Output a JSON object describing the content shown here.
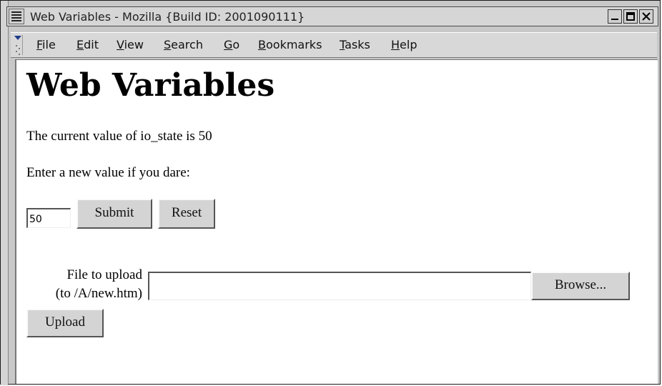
{
  "window": {
    "title": "Web Variables - Mozilla {Build ID: 2001090111}"
  },
  "menubar": {
    "items": [
      {
        "label": "File",
        "underline": "F",
        "rest": "ile"
      },
      {
        "label": "Edit",
        "underline": "E",
        "rest": "dit"
      },
      {
        "label": "View",
        "underline": "V",
        "rest": "iew"
      },
      {
        "label": "Search",
        "underline": "S",
        "rest": "earch"
      },
      {
        "label": "Go",
        "underline": "G",
        "rest": "o"
      },
      {
        "label": "Bookmarks",
        "underline": "B",
        "rest": "ookmarks"
      },
      {
        "label": "Tasks",
        "underline": "T",
        "rest": "asks"
      },
      {
        "label": "Help",
        "underline": "H",
        "rest": "elp"
      }
    ]
  },
  "page": {
    "heading": "Web Variables",
    "current_value_text": "The current value of io_state is 50",
    "prompt_text": "Enter a new value if you dare:",
    "value_input": "50",
    "submit_label": "Submit",
    "reset_label": "Reset",
    "upload_label_line1": "File to upload",
    "upload_label_line2": "(to /A/new.htm)",
    "file_input_value": "",
    "browse_label": "Browse...",
    "upload_button_label": "Upload"
  }
}
